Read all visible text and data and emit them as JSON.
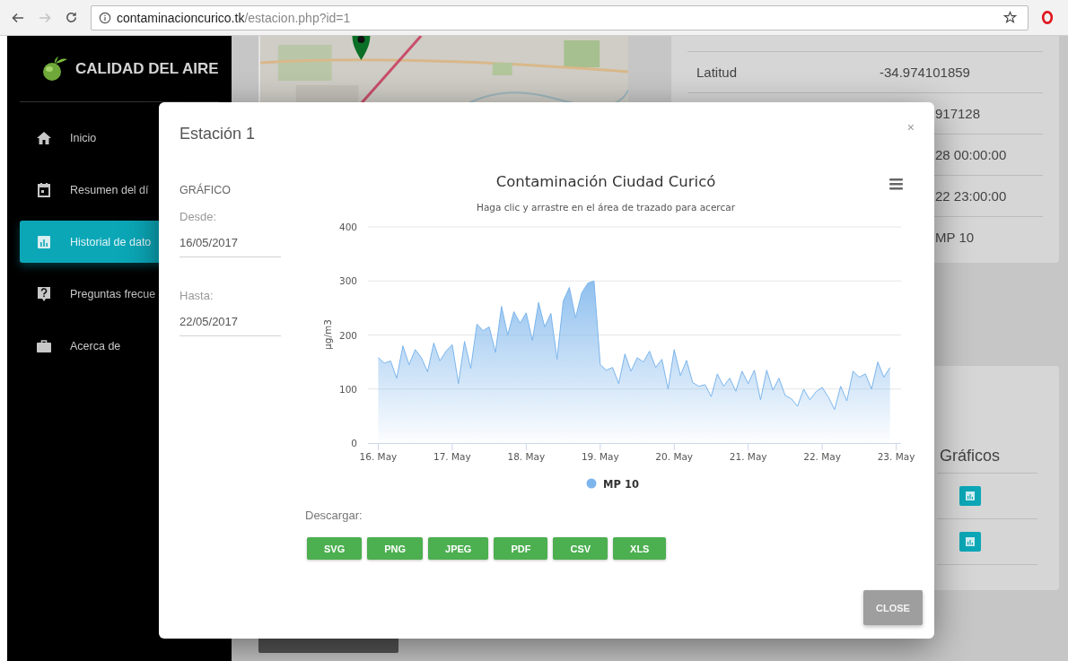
{
  "browser": {
    "forward_disabled": true,
    "url_domain": "contaminacioncurico.tk",
    "url_path": "/estacion.php?id=1"
  },
  "sidebar": {
    "brand": "CALIDAD DEL AIRE",
    "items": [
      {
        "label": "Inicio",
        "selected": false
      },
      {
        "label": "Resumen del dí",
        "selected": false
      },
      {
        "label": "Historial de dato",
        "selected": true
      },
      {
        "label": "Preguntas frecue",
        "selected": false
      },
      {
        "label": "Acerca de",
        "selected": false
      }
    ]
  },
  "station_card": {
    "rows": [
      {
        "label": "Latitud",
        "value": "-34.974101859"
      },
      {
        "value": "917128"
      },
      {
        "value": "28 00:00:00"
      },
      {
        "value": "22 23:00:00"
      },
      {
        "value": "MP 10"
      }
    ]
  },
  "charts_card": {
    "heading": "Gráficos",
    "buttons": [
      {
        "kind": "chart"
      },
      {
        "kind": "chart"
      }
    ]
  },
  "modal": {
    "title": "Estación 1",
    "close_symbol": "×",
    "section": "GRÁFICO",
    "fields": [
      {
        "label": "Desde:",
        "value": "16/05/2017"
      },
      {
        "label": "Hasta:",
        "value": "22/05/2017"
      }
    ],
    "chart_subtitle": "Haga clic y arrastre en el área de trazado para acercar",
    "chart_data": {
      "type": "area",
      "title": "Contaminación Ciudad Curicó",
      "ylabel": "μg/m3",
      "categories": [
        "16. May",
        null,
        null,
        null,
        null,
        null,
        null,
        null,
        null,
        null,
        null,
        null,
        "17. May",
        null,
        null,
        null,
        null,
        null,
        null,
        null,
        null,
        null,
        null,
        null,
        "18. May",
        null,
        null,
        null,
        null,
        null,
        null,
        null,
        null,
        null,
        null,
        null,
        "19. May",
        null,
        null,
        null,
        null,
        null,
        null,
        null,
        null,
        null,
        null,
        null,
        "20. May",
        null,
        null,
        null,
        null,
        null,
        null,
        null,
        null,
        null,
        null,
        null,
        "21. May",
        null,
        null,
        null,
        null,
        null,
        null,
        null,
        null,
        null,
        null,
        null,
        "22. May",
        null,
        null,
        null,
        null,
        null,
        null,
        null,
        null,
        null,
        null,
        null,
        "23. May"
      ],
      "series": [
        {
          "name": "MP 10",
          "color": "#7cb5ec",
          "values": [
            158,
            148,
            152,
            120,
            180,
            145,
            173,
            158,
            132,
            185,
            152,
            170,
            182,
            110,
            188,
            138,
            220,
            208,
            215,
            168,
            253,
            200,
            243,
            222,
            241,
            190,
            260,
            215,
            240,
            155,
            263,
            288,
            232,
            278,
            296,
            300,
            145,
            135,
            140,
            110,
            165,
            133,
            158,
            150,
            170,
            140,
            155,
            100,
            173,
            125,
            153,
            112,
            105,
            108,
            86,
            128,
            105,
            120,
            96,
            133,
            110,
            135,
            80,
            135,
            98,
            120,
            88,
            82,
            68,
            100,
            80,
            95,
            103,
            85,
            62,
            105,
            78,
            133,
            122,
            128,
            100,
            150,
            122,
            140,
            null
          ]
        }
      ],
      "ylim": [
        0,
        400
      ],
      "grid": true,
      "yticks": [
        0,
        100,
        200,
        300,
        400
      ]
    },
    "download_label": "Descargar:",
    "download_buttons": [
      "SVG",
      "PNG",
      "JPEG",
      "PDF",
      "CSV",
      "XLS"
    ],
    "close_button": "CLOSE"
  }
}
